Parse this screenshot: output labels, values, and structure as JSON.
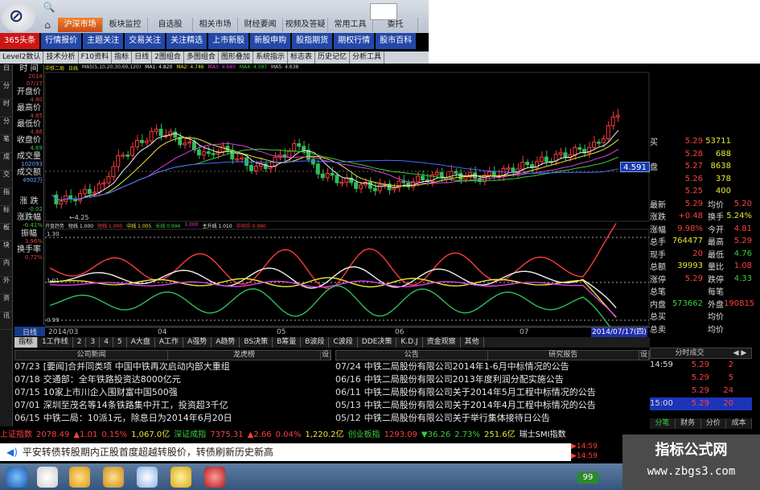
{
  "main_menu": [
    "沪深市场",
    "板块监控",
    "自选股",
    "相关市场",
    "财经要闻",
    "视频及答疑",
    "常用工具",
    "委托"
  ],
  "sub_menu": [
    "365头条",
    "行情报价",
    "主题关注",
    "交易关注",
    "关注精选",
    "上市新股",
    "新股申购",
    "股指期货",
    "期权行情",
    "股市百科"
  ],
  "tool_row": [
    "Level2数认",
    "技术分析",
    "F10资料",
    "指标",
    "日线",
    "2图组合",
    "多图组合",
    "图形叠加",
    "系统指示",
    "标志表",
    "历史记忆",
    "分析工具"
  ],
  "side_tabs": [
    "日",
    "分",
    "时",
    "分",
    "笔",
    "成",
    "交",
    "指",
    "标",
    "板",
    "块",
    "内",
    "外",
    "资",
    "讯"
  ],
  "info_labels": [
    {
      "label": "时 间",
      "value": "2014",
      "cls": ""
    },
    {
      "label": "",
      "value": "07/17",
      "cls": ""
    },
    {
      "label": "开盘价",
      "value": "4.80",
      "cls": ""
    },
    {
      "label": "最高价",
      "value": "4.85",
      "cls": ""
    },
    {
      "label": "最低价",
      "value": "4.66",
      "cls": ""
    },
    {
      "label": "收盘价",
      "value": "4.69",
      "cls": "grn"
    },
    {
      "label": "成交量",
      "value": "102093",
      "cls": "blu"
    },
    {
      "label": "成交额",
      "value": "4902万",
      "cls": "blu"
    },
    {
      "label": "涨 跌",
      "value": "-0.02",
      "cls": "grn"
    },
    {
      "label": "涨跌幅",
      "value": "-0.41%",
      "cls": "grn"
    },
    {
      "label": "振幅",
      "value": "3.96%",
      "cls": ""
    },
    {
      "label": "换手率",
      "value": "0.72%",
      "cls": ""
    }
  ],
  "ma_legend": [
    {
      "text": "中铁二局",
      "color": "#e8e838"
    },
    {
      "text": "日线",
      "color": "#e8e838"
    },
    {
      "text": "MA5(5,10,20,30,60,120)",
      "color": "#ccc"
    },
    {
      "text": "MA1: 4.820",
      "color": "#eee"
    },
    {
      "text": "MA2: 4.746",
      "color": "#e8e838"
    },
    {
      "text": "MA3: 4.640",
      "color": "#e040e0"
    },
    {
      "text": "MA4: 4.597",
      "color": "#39d039"
    },
    {
      "text": "MA5: 4.638",
      "color": "#ccc"
    }
  ],
  "ind_legend": [
    {
      "text": "开盘趋势",
      "color": "#ccc"
    },
    {
      "text": "短线 1.000",
      "color": "#eee"
    },
    {
      "text": "短线 1.000",
      "color": "#ff4040"
    },
    {
      "text": "中线 1.005",
      "color": "#e8e838"
    },
    {
      "text": "长线 0.996",
      "color": "#39d039"
    },
    {
      "text": "1.000",
      "color": "#e040e0"
    },
    {
      "text": "主升线 1.010",
      "color": "#eee"
    },
    {
      "text": "中间位 0.990",
      "color": "#ff4040"
    }
  ],
  "price_axis_low": "4.25",
  "price_tag": "4.591",
  "ind_labels": [
    "1.30",
    "1.01",
    "0.99"
  ],
  "date_axis": [
    {
      "label": "2014/03"
    },
    {
      "label": "04"
    },
    {
      "label": "05"
    },
    {
      "label": "06"
    },
    {
      "label": "07"
    }
  ],
  "date_flag": "2014/07/17(四)",
  "day_label": "日线",
  "period_tabs": [
    "指标",
    "1工作线",
    "2",
    "3",
    "4",
    "5",
    "A大盘",
    "A工作",
    "A强势",
    "A趋势",
    "BS决策",
    "B筹量",
    "B波段",
    "C波段",
    "DDE决策",
    "K.D.J",
    "资金观察",
    "其他"
  ],
  "quote": {
    "asks": [
      {
        "label": "",
        "price": "",
        "vol": ""
      },
      {
        "label": "",
        "price": "",
        "vol": ""
      },
      {
        "label": "买",
        "price": "5.29",
        "vol": "53711"
      },
      {
        "label": "",
        "price": "5.28",
        "vol": "688"
      },
      {
        "label": "盘",
        "price": "5.27",
        "vol": "8638"
      },
      {
        "label": "",
        "price": "5.26",
        "vol": "378"
      },
      {
        "label": "",
        "price": "5.25",
        "vol": "400"
      }
    ],
    "stats": [
      {
        "a": "最新",
        "b": "5.29",
        "bc": "red",
        "c": "均价",
        "e": "5.20",
        "ec": "red"
      },
      {
        "a": "涨跌",
        "b": "+0.48",
        "bc": "red",
        "c": "换手",
        "e": "5.24%",
        "ec": "yel"
      },
      {
        "a": "涨幅",
        "b": "9.98%",
        "bc": "red",
        "c": "今开",
        "e": "4.81",
        "ec": "red"
      },
      {
        "a": "总手",
        "b": "764477",
        "bc": "yel",
        "c": "最高",
        "e": "5.29",
        "ec": "red"
      },
      {
        "a": "现手",
        "b": "20",
        "bc": "red",
        "c": "最低",
        "e": "4.76",
        "ec": "grn"
      },
      {
        "a": "总额",
        "b": "39993",
        "bc": "yel",
        "c": "量比",
        "e": "1.08",
        "ec": "red"
      },
      {
        "a": "涨停",
        "b": "5.29",
        "bc": "red",
        "c": "跌停",
        "e": "4.33",
        "ec": "grn"
      },
      {
        "a": "总笔",
        "b": "",
        "bc": "wht",
        "c": "每笔",
        "e": "",
        "ec": "wht"
      },
      {
        "a": "内盘",
        "b": "573662",
        "bc": "grn",
        "c": "外盘",
        "e": "190815",
        "ec": "red"
      },
      {
        "a": "总买",
        "b": "",
        "bc": "wht",
        "c": "均价",
        "e": "",
        "ec": "wht"
      },
      {
        "a": "总卖",
        "b": "",
        "bc": "wht",
        "c": "均价",
        "e": "",
        "ec": "wht"
      }
    ]
  },
  "ts_head": "分时成交",
  "time_sales": [
    {
      "t": "14:59",
      "p": "5.29",
      "v": "2"
    },
    {
      "t": "",
      "p": "5.29",
      "v": "5"
    },
    {
      "t": "",
      "p": "5.29",
      "v": "24"
    },
    {
      "t": "15:00",
      "p": "5.29",
      "v": "20"
    }
  ],
  "ts_tabs": [
    "分笔",
    "财务",
    "分价",
    "成本"
  ],
  "news_left": {
    "heads": [
      "公司新闻",
      "龙虎榜",
      "设"
    ],
    "rows": [
      {
        "d": "07/23",
        "t": "[要闻]合并同类项 中国中铁再次启动内部大重组"
      },
      {
        "d": "07/18",
        "t": "交通部：全年铁路投资达8000亿元"
      },
      {
        "d": "07/15",
        "t": "10家上市川企入围财富中国500强"
      },
      {
        "d": "07/01",
        "t": "深圳至茂名等14条铁路集中开工，投资超3千亿"
      },
      {
        "d": "06/15",
        "t": "中铁二局：10派1元，除息日为2014年6月20日"
      }
    ]
  },
  "news_right": {
    "heads": [
      "公告",
      "研究报告",
      "设"
    ],
    "rows": [
      {
        "d": "07/24",
        "t": "中铁二局股份有限公司2014年1-6月中标情况的公告"
      },
      {
        "d": "06/16",
        "t": "中铁二局股份有限公司2013年度利润分配实施公告"
      },
      {
        "d": "06/11",
        "t": "中铁二局股份有限公司关于2014年5月工程中标情况的公告"
      },
      {
        "d": "05/13",
        "t": "中铁二局股份有限公司关于2014年4月工程中标情况的公告"
      },
      {
        "d": "05/12",
        "t": "中铁二局股份有限公司关于举行集体接待日公告"
      }
    ]
  },
  "ticker": [
    {
      "t": "上证指数",
      "c": "red"
    },
    {
      "t": "2078.49",
      "c": "red"
    },
    {
      "t": "▲1.01",
      "c": "red"
    },
    {
      "t": "0.15%",
      "c": "red"
    },
    {
      "t": "1,067.0亿",
      "c": "yel"
    },
    {
      "t": "深证成指",
      "c": "grn"
    },
    {
      "t": "7375.31",
      "c": "red"
    },
    {
      "t": "▲2.66",
      "c": "red"
    },
    {
      "t": "0.04%",
      "c": "red"
    },
    {
      "t": "1,220.2亿",
      "c": "yel"
    },
    {
      "t": "创业板指",
      "c": "grn"
    },
    {
      "t": "1293.09",
      "c": "red"
    },
    {
      "t": "▼36.26",
      "c": "grn"
    },
    {
      "t": "2.73%",
      "c": "grn"
    },
    {
      "t": "251.6亿",
      "c": "yel"
    },
    {
      "t": "瑞士SMI指数",
      "c": "wht"
    }
  ],
  "marquee": "平安转债转股期内正股首度超越转股价，转债刷新历史新高",
  "mini_ts": [
    "14:59",
    "14:59"
  ],
  "watermark": {
    "line1": "指标公式网",
    "line2": "www.zbgs3.com"
  },
  "tray_label": "99"
}
